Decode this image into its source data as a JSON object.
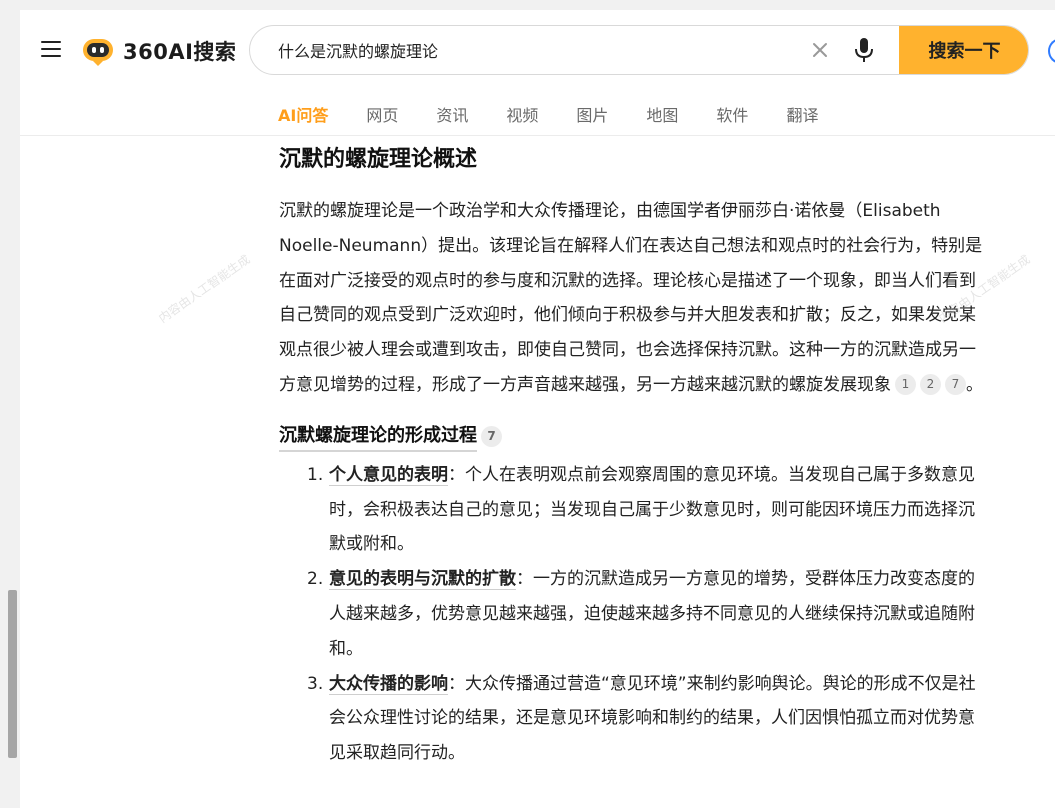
{
  "header": {
    "logo_text": "360AI搜索",
    "search": {
      "value": "什么是沉默的螺旋理论",
      "placeholder": ""
    },
    "search_button": "搜索一下",
    "tabs": [
      {
        "label": "AI问答",
        "active": true
      },
      {
        "label": "网页"
      },
      {
        "label": "资讯"
      },
      {
        "label": "视频"
      },
      {
        "label": "图片"
      },
      {
        "label": "地图"
      },
      {
        "label": "软件"
      },
      {
        "label": "翻译"
      }
    ],
    "accent_color": "#ffb22e",
    "active_tab_color": "#ff9e1b"
  },
  "article": {
    "title": "沉默的螺旋理论概述",
    "intro": "沉默的螺旋理论是一个政治学和大众传播理论，由德国学者伊丽莎白·诺依曼（Elisabeth Noelle-Neumann）提出。该理论旨在解释人们在表达自己想法和观点时的社会行为，特别是在面对广泛接受的观点时的参与度和沉默的选择。理论核心是描述了一个现象，即当人们看到自己赞同的观点受到广泛欢迎时，他们倾向于积极参与并大胆发表和扩散；反之，如果发觉某观点很少被人理会或遭到攻击，即使自己赞同，也会选择保持沉默。这种一方的沉默造成另一方意见增势的过程，形成了一方声音越来越强，另一方越来越沉默的螺旋发展现象",
    "intro_citations": [
      "1",
      "2",
      "7"
    ],
    "intro_end": "。",
    "section_title": "沉默螺旋理论的形成过程",
    "section_citation": "7",
    "steps": [
      {
        "num": "1.",
        "term": "个人意见的表明",
        "text": "：个人在表明观点前会观察周围的意见环境。当发现自己属于多数意见时，会积极表达自己的意见；当发现自己属于少数意见时，则可能因环境压力而选择沉默或附和。"
      },
      {
        "num": "2.",
        "term": "意见的表明与沉默的扩散",
        "text": "：一方的沉默造成另一方意见的增势，受群体压力改变态度的人越来越多，优势意见越来越强，迫使越来越多持不同意见的人继续保持沉默或追随附和。"
      },
      {
        "num": "3.",
        "term": "大众传播的影响",
        "text": "：大众传播通过营造“意见环境”来制约影响舆论。舆论的形成不仅是社会公众理性讨论的结果，还是意见环境影响和制约的结果，人们因惧怕孤立而对优势意见采取趋同行动。"
      }
    ]
  },
  "watermark_text": "内容由人工智能生成"
}
